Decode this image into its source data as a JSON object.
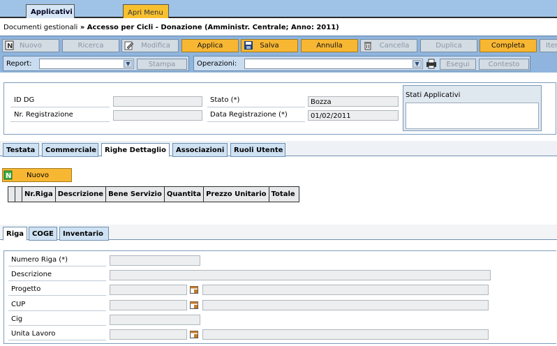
{
  "topbar": {
    "tab_applicativi": "Applicativi",
    "tab_apri_menu": "Apri Menu"
  },
  "breadcrumb": {
    "root": "Documenti gestionali",
    "separator": "»",
    "current": "Accesso per Cicli - Donazione (Amministr. Centrale; Anno: 2011)"
  },
  "toolbar": {
    "nuovo": "Nuovo",
    "ricerca": "Ricerca",
    "modifica": "Modifica",
    "applica": "Applica",
    "salva": "Salva",
    "annulla": "Annulla",
    "cancella": "Cancella",
    "duplica": "Duplica",
    "completa": "Completa",
    "iter": "Iter",
    "report_label": "Report:",
    "report_value": "",
    "stampa": "Stampa",
    "operazioni_label": "Operazioni:",
    "operazioni_value": "",
    "esegui": "Esegui",
    "contesto": "Contesto"
  },
  "header": {
    "id_dg_label": "ID DG",
    "id_dg_value": "",
    "nr_registrazione_label": "Nr. Registrazione",
    "nr_registrazione_value": "",
    "stato_label": "Stato (*)",
    "stato_value": "Bozza",
    "data_registrazione_label": "Data Registrazione (*)",
    "data_registrazione_value": "01/02/2011",
    "stati_applicativi_label": "Stati Applicativi"
  },
  "tabs_main": [
    "Testata",
    "Commerciale",
    "Righe Dettaglio",
    "Associazioni",
    "Ruoli Utente"
  ],
  "grid": {
    "nuovo_label": "Nuovo",
    "columns": [
      "Nr.Riga",
      "Descrizione",
      "Bene Servizio",
      "Quantita",
      "Prezzo Unitario",
      "Totale"
    ]
  },
  "tabs_riga": [
    "Riga",
    "COGE",
    "Inventario"
  ],
  "riga_form": {
    "numero_riga_label": "Numero Riga (*)",
    "numero_riga_value": "",
    "descrizione_label": "Descrizione",
    "descrizione_value": "",
    "progetto_label": "Progetto",
    "progetto_code": "",
    "progetto_desc": "",
    "cup_label": "CUP",
    "cup_code": "",
    "cup_desc": "",
    "cig_label": "Cig",
    "cig_value": "",
    "unita_lavoro_label": "Unita Lavoro",
    "unita_lavoro_code": "",
    "unita_lavoro_desc": ""
  },
  "colors": {
    "topbar": "#9fc3e6",
    "toolbar": "#8fb5de",
    "accent_button": "#f8b733",
    "disabled_button": "#d3dbe3"
  },
  "icons": [
    "new-doc-icon",
    "edit-icon",
    "save-disk-icon",
    "trash-icon",
    "dropdown-arrow-icon",
    "printer-icon",
    "lookup-picker-icon"
  ]
}
